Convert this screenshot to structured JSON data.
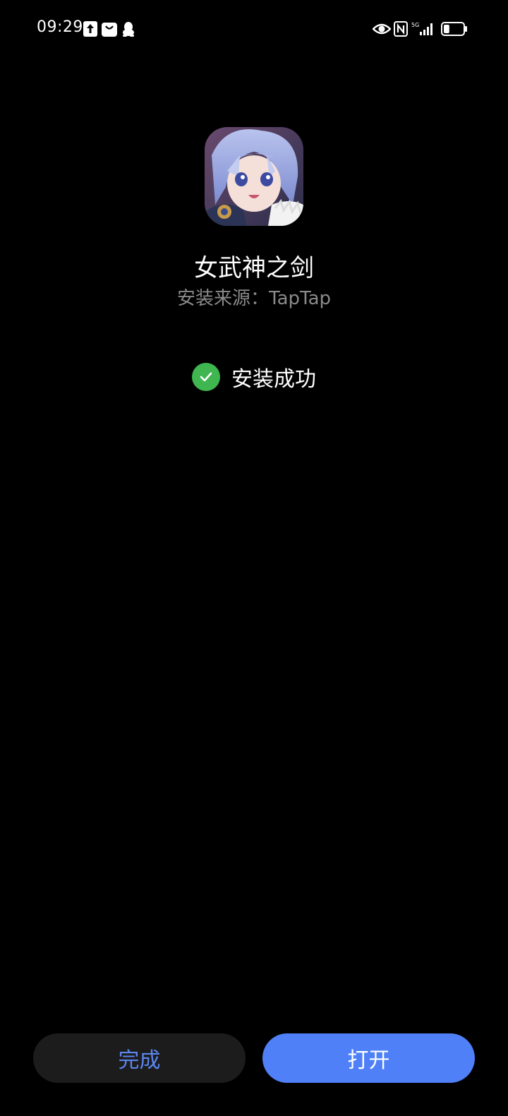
{
  "status_bar": {
    "time": "09:29",
    "network": "5G",
    "icons": [
      "upload-icon",
      "shopping-bag-icon",
      "qq-penguin-icon",
      "eye-icon",
      "nfc-icon",
      "signal-icon",
      "battery-icon"
    ],
    "battery_level": 0.3
  },
  "app": {
    "name": "女武神之剑",
    "source": "安装来源：TapTap",
    "icon": "anime-girl-app-icon"
  },
  "install": {
    "status": "安装成功",
    "status_icon": "check-icon",
    "status_color": "#3fb650"
  },
  "actions": {
    "done_label": "完成",
    "open_label": "打开",
    "accent_color": "#4f80f7"
  }
}
